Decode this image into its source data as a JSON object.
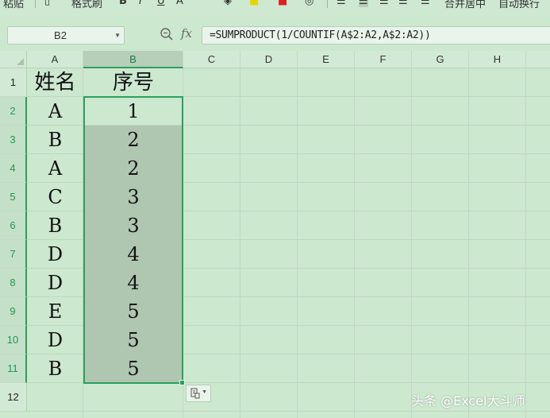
{
  "toolbar": {
    "items": [
      "粘贴",
      "格式刷",
      "B",
      "I",
      "U",
      "A",
      "合并居中",
      "自动换行"
    ]
  },
  "formula_bar": {
    "name_box": "B2",
    "fx_label": "fx",
    "formula": "=SUMPRODUCT(1/COUNTIF(A$2:A2,A$2:A2))"
  },
  "sheet": {
    "columns": [
      "A",
      "B",
      "C",
      "D",
      "E",
      "F",
      "G",
      "H"
    ],
    "rows": [
      "1",
      "2",
      "3",
      "4",
      "5",
      "6",
      "7",
      "8",
      "9",
      "10",
      "11",
      "12"
    ],
    "header": {
      "name": "姓名",
      "seq": "序号"
    },
    "data": [
      {
        "name": "A",
        "seq": "1"
      },
      {
        "name": "B",
        "seq": "2"
      },
      {
        "name": "A",
        "seq": "2"
      },
      {
        "name": "C",
        "seq": "3"
      },
      {
        "name": "B",
        "seq": "3"
      },
      {
        "name": "D",
        "seq": "4"
      },
      {
        "name": "D",
        "seq": "4"
      },
      {
        "name": "E",
        "seq": "5"
      },
      {
        "name": "D",
        "seq": "5"
      },
      {
        "name": "B",
        "seq": "5"
      }
    ],
    "selected_column": "B",
    "selected_range": "B2:B11"
  },
  "colors": {
    "background": "#cce8cf",
    "selection_border": "#2aa05f",
    "selection_fill": "#afc6b1"
  },
  "watermark": "头条 @Excel大斗师"
}
